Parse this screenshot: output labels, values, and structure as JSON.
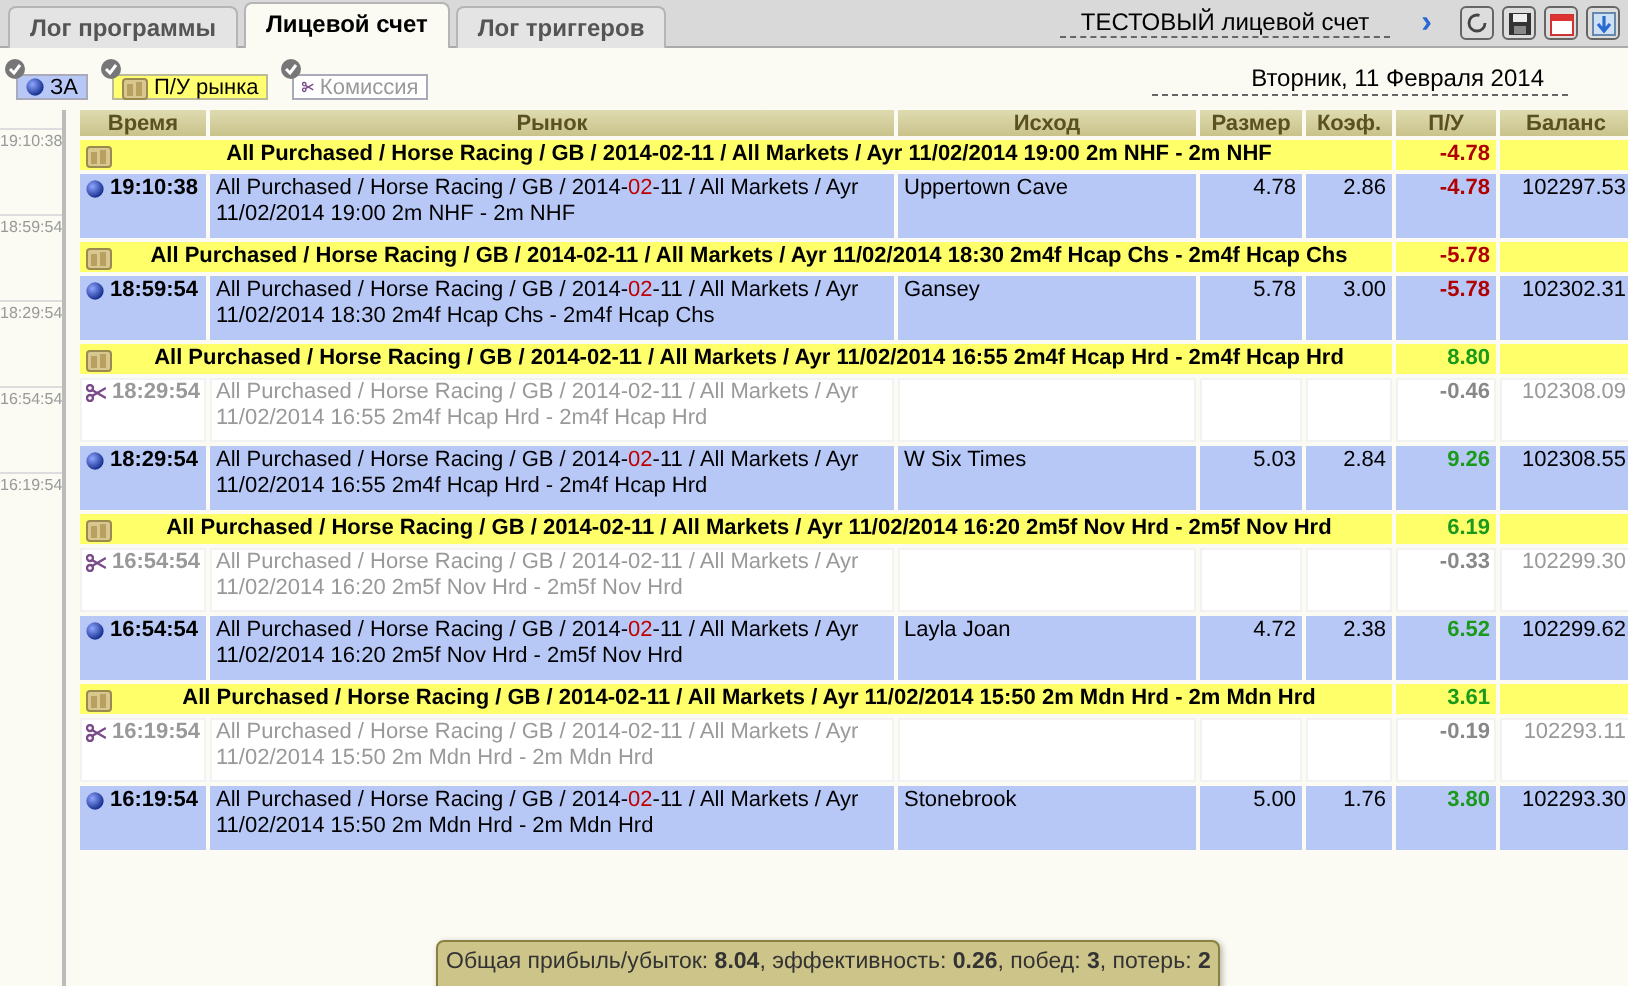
{
  "tabs": [
    {
      "label": "Лог программы",
      "selected": false
    },
    {
      "label": "Лицевой счет",
      "selected": true
    },
    {
      "label": "Лог триггеров",
      "selected": false
    }
  ],
  "account": {
    "label": "ТЕСТОВЫЙ лицевой счет",
    "next": "›"
  },
  "filters": [
    {
      "kind": "back",
      "label": "ЗА",
      "on": true
    },
    {
      "kind": "group",
      "label": "П/У рынка",
      "on": true
    },
    {
      "kind": "commission",
      "label": "Комиссия",
      "on": true
    }
  ],
  "date": "Вторник, 11 Февраля 2014",
  "timeline": [
    "19:10:38",
    "18:59:54",
    "18:29:54",
    "16:54:54",
    "16:19:54"
  ],
  "columns": [
    "Время",
    "Рынок",
    "Исход",
    "Размер",
    "Коэф.",
    "П/У",
    "Баланс"
  ],
  "rows": [
    {
      "kind": "group",
      "market": "All Purchased / Horse Racing / GB / 2014-02-11 / All Markets / Ayr 11/02/2014 19:00 2m NHF - 2m NHF",
      "pl": "-4.78",
      "color": "#b00000"
    },
    {
      "kind": "back",
      "time": "19:10:38",
      "market_pre": "All Purchased / Horse Racing / GB / 2014-",
      "market_mark": "02",
      "market_post": "-11 / All Markets / Ayr 11/02/2014 19:00 2m NHF - 2m NHF",
      "selection": "Uppertown Cave",
      "size": "4.78",
      "odds": "2.86",
      "pl": "-4.78",
      "color": "#b00000",
      "balance": "102297.53"
    },
    {
      "kind": "group",
      "market": "All Purchased / Horse Racing / GB / 2014-02-11 / All Markets / Ayr 11/02/2014 18:30 2m4f Hcap Chs - 2m4f Hcap Chs",
      "pl": "-5.78",
      "color": "#b00000"
    },
    {
      "kind": "back",
      "time": "18:59:54",
      "market_pre": "All Purchased / Horse Racing / GB / 2014-",
      "market_mark": "02",
      "market_post": "-11 / All Markets / Ayr 11/02/2014 18:30 2m4f Hcap Chs - 2m4f Hcap Chs",
      "selection": "Gansey",
      "size": "5.78",
      "odds": "3.00",
      "pl": "-5.78",
      "color": "#b00000",
      "balance": "102302.31"
    },
    {
      "kind": "group",
      "market": "All Purchased / Horse Racing / GB / 2014-02-11 / All Markets / Ayr 11/02/2014 16:55 2m4f Hcap Hrd - 2m4f Hcap Hrd",
      "pl": "8.80",
      "color": "#1a9a1a"
    },
    {
      "kind": "commission",
      "time": "18:29:54",
      "market_pre": "All Purchased / Horse Racing / GB / 2014-02-11 / All Markets / Ayr 11/02/2014 16:55 2m4f Hcap Hrd - 2m4f Hcap Hrd",
      "pl": "-0.46",
      "color": "#888888",
      "balance": "102308.09"
    },
    {
      "kind": "back",
      "time": "18:29:54",
      "market_pre": "All Purchased / Horse Racing / GB / 2014-",
      "market_mark": "02",
      "market_post": "-11 / All Markets / Ayr 11/02/2014 16:55 2m4f Hcap Hrd - 2m4f Hcap Hrd",
      "selection": "W Six Times",
      "size": "5.03",
      "odds": "2.84",
      "pl": "9.26",
      "color": "#1a9a1a",
      "balance": "102308.55"
    },
    {
      "kind": "group",
      "market": "All Purchased / Horse Racing / GB / 2014-02-11 / All Markets / Ayr 11/02/2014 16:20 2m5f Nov Hrd - 2m5f Nov Hrd",
      "pl": "6.19",
      "color": "#1a9a1a"
    },
    {
      "kind": "commission",
      "time": "16:54:54",
      "market_pre": "All Purchased / Horse Racing / GB / 2014-02-11 / All Markets / Ayr 11/02/2014 16:20 2m5f Nov Hrd - 2m5f Nov Hrd",
      "pl": "-0.33",
      "color": "#888888",
      "balance": "102299.30"
    },
    {
      "kind": "back",
      "time": "16:54:54",
      "market_pre": "All Purchased / Horse Racing / GB / 2014-",
      "market_mark": "02",
      "market_post": "-11 / All Markets / Ayr 11/02/2014 16:20 2m5f Nov Hrd - 2m5f Nov Hrd",
      "selection": "Layla Joan",
      "size": "4.72",
      "odds": "2.38",
      "pl": "6.52",
      "color": "#1a9a1a",
      "balance": "102299.62"
    },
    {
      "kind": "group",
      "market": "All Purchased / Horse Racing / GB / 2014-02-11 / All Markets / Ayr 11/02/2014 15:50 2m Mdn Hrd - 2m Mdn Hrd",
      "pl": "3.61",
      "color": "#1a9a1a"
    },
    {
      "kind": "commission",
      "time": "16:19:54",
      "market_pre": "All Purchased / Horse Racing / GB / 2014-02-11 / All Markets / Ayr 11/02/2014 15:50 2m Mdn Hrd - 2m Mdn Hrd",
      "pl": "-0.19",
      "color": "#888888",
      "balance": "102293.11"
    },
    {
      "kind": "back",
      "time": "16:19:54",
      "market_pre": "All Purchased / Horse Racing / GB / 2014-",
      "market_mark": "02",
      "market_post": "-11 / All Markets / Ayr 11/02/2014 15:50 2m Mdn Hrd - 2m Mdn Hrd",
      "selection": "Stonebrook",
      "size": "5.00",
      "odds": "1.76",
      "pl": "3.80",
      "color": "#1a9a1a",
      "balance": "102293.30"
    }
  ],
  "summary": "Общая прибыль/убыток: **8.04**, эффективность: **0.26**, побед: **3**, потерь: **2**"
}
